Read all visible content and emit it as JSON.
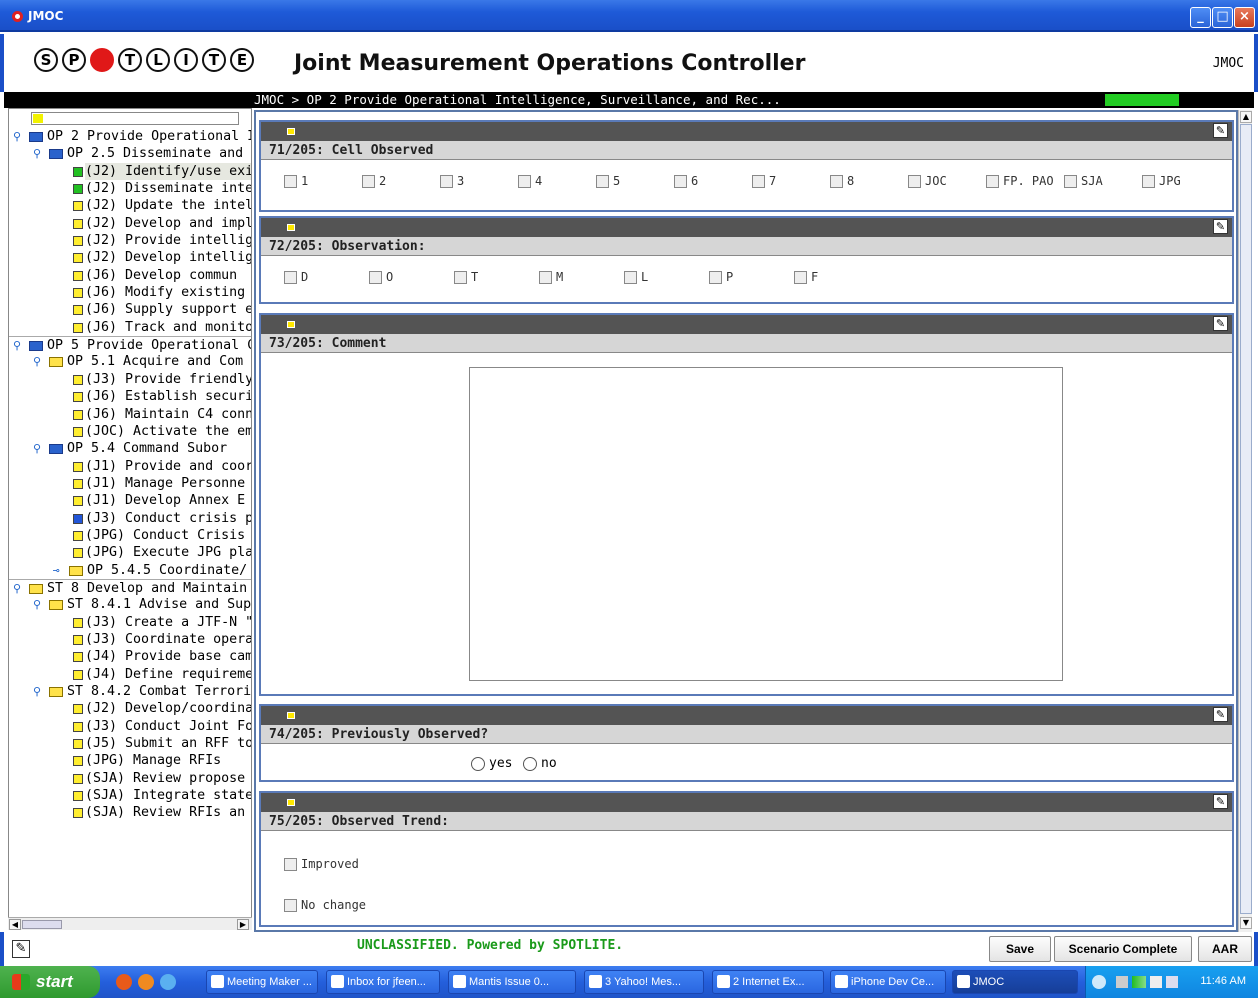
{
  "window": {
    "title": "JMOC",
    "controls": [
      "minimize",
      "maximize",
      "close"
    ]
  },
  "header": {
    "logo_letters": [
      "S",
      "P",
      "",
      "T",
      "L",
      "I",
      "T",
      "E"
    ],
    "title": "Joint Measurement Operations Controller",
    "tag": "JMOC"
  },
  "breadcrumb": {
    "text": "JMOC > OP 2 Provide Operational Intelligence, Surveillance, and Rec...",
    "status_color": "#22cc22"
  },
  "tree": {
    "rows": [
      {
        "label": "OP 2 Provide Operational I",
        "indent": 0,
        "kind": "folder-blue",
        "expand": "open",
        "sep": false
      },
      {
        "label": "OP 2.5 Disseminate and",
        "indent": 1,
        "kind": "folder-blue",
        "expand": "open",
        "sep": false
      },
      {
        "label": "(J2) Identify/use exis",
        "indent": 2,
        "kind": "green",
        "expand": "",
        "sep": false,
        "selected": true
      },
      {
        "label": "(J2) Disseminate intell",
        "indent": 2,
        "kind": "green",
        "expand": "",
        "sep": false
      },
      {
        "label": "(J2) Update the intelli",
        "indent": 2,
        "kind": "yellow",
        "expand": "",
        "sep": false
      },
      {
        "label": "(J2) Develop and impl",
        "indent": 2,
        "kind": "yellow",
        "expand": "",
        "sep": false
      },
      {
        "label": "(J2) Provide intelligen",
        "indent": 2,
        "kind": "yellow",
        "expand": "",
        "sep": false
      },
      {
        "label": "(J2) Develop intelliger",
        "indent": 2,
        "kind": "yellow",
        "expand": "",
        "sep": false
      },
      {
        "label": "(J6) Develop commun",
        "indent": 2,
        "kind": "yellow",
        "expand": "",
        "sep": false
      },
      {
        "label": "(J6) Modify existing cc",
        "indent": 2,
        "kind": "yellow",
        "expand": "",
        "sep": false
      },
      {
        "label": "(J6) Supply support e",
        "indent": 2,
        "kind": "yellow",
        "expand": "",
        "sep": false
      },
      {
        "label": "(J6) Track and monito",
        "indent": 2,
        "kind": "yellow",
        "expand": "",
        "sep": false
      },
      {
        "label": "OP 5 Provide Operational C",
        "indent": 0,
        "kind": "folder-blue",
        "expand": "open",
        "sep": true
      },
      {
        "label": "OP 5.1 Acquire and Com",
        "indent": 1,
        "kind": "folder-yellow",
        "expand": "open",
        "sep": false
      },
      {
        "label": "(J3) Provide friendly f",
        "indent": 2,
        "kind": "yellow",
        "expand": "",
        "sep": false
      },
      {
        "label": "(J6) Establish security",
        "indent": 2,
        "kind": "yellow",
        "expand": "",
        "sep": false
      },
      {
        "label": "(J6) Maintain C4 conn",
        "indent": 2,
        "kind": "yellow",
        "expand": "",
        "sep": false
      },
      {
        "label": "(JOC) Activate the em",
        "indent": 2,
        "kind": "yellow",
        "expand": "",
        "sep": false
      },
      {
        "label": "OP 5.4 Command Subor",
        "indent": 1,
        "kind": "folder-blue",
        "expand": "open",
        "sep": false
      },
      {
        "label": "(J1) Provide and coor",
        "indent": 2,
        "kind": "yellow",
        "expand": "",
        "sep": false
      },
      {
        "label": "(J1) Manage Personne",
        "indent": 2,
        "kind": "yellow",
        "expand": "",
        "sep": false
      },
      {
        "label": "(J1) Develop Annex E",
        "indent": 2,
        "kind": "yellow",
        "expand": "",
        "sep": false
      },
      {
        "label": "(J3) Conduct crisis pla",
        "indent": 2,
        "kind": "blue",
        "expand": "",
        "sep": false
      },
      {
        "label": "(JPG) Conduct Crisis A",
        "indent": 2,
        "kind": "yellow",
        "expand": "",
        "sep": false
      },
      {
        "label": "(JPG) Execute JPG pla",
        "indent": 2,
        "kind": "yellow",
        "expand": "",
        "sep": false
      },
      {
        "label": "OP 5.4.5 Coordinate/",
        "indent": 2,
        "kind": "folder-yellow",
        "expand": "closed",
        "sep": false
      },
      {
        "label": "ST 8 Develop and Maintain",
        "indent": 0,
        "kind": "folder-yellow",
        "expand": "open",
        "sep": true
      },
      {
        "label": "ST 8.4.1 Advise and Sup",
        "indent": 1,
        "kind": "folder-yellow",
        "expand": "open",
        "sep": false
      },
      {
        "label": "(J3) Create a JTF-N \"f",
        "indent": 2,
        "kind": "yellow",
        "expand": "",
        "sep": false
      },
      {
        "label": "(J3) Coordinate opera",
        "indent": 2,
        "kind": "yellow",
        "expand": "",
        "sep": false
      },
      {
        "label": "(J4) Provide base cam",
        "indent": 2,
        "kind": "yellow",
        "expand": "",
        "sep": false
      },
      {
        "label": "(J4) Define requireme",
        "indent": 2,
        "kind": "yellow",
        "expand": "",
        "sep": false
      },
      {
        "label": "ST 8.4.2 Combat Terrori",
        "indent": 1,
        "kind": "folder-yellow",
        "expand": "open",
        "sep": false
      },
      {
        "label": "(J2) Develop/coordina",
        "indent": 2,
        "kind": "yellow",
        "expand": "",
        "sep": false
      },
      {
        "label": "(J3) Conduct Joint Fo",
        "indent": 2,
        "kind": "yellow",
        "expand": "",
        "sep": false
      },
      {
        "label": "(J5) Submit an RFF to",
        "indent": 2,
        "kind": "yellow",
        "expand": "",
        "sep": false
      },
      {
        "label": "(JPG) Manage RFIs",
        "indent": 2,
        "kind": "yellow",
        "expand": "",
        "sep": false
      },
      {
        "label": "(SJA) Review propose",
        "indent": 2,
        "kind": "yellow",
        "expand": "",
        "sep": false
      },
      {
        "label": "(SJA) Integrate state",
        "indent": 2,
        "kind": "yellow",
        "expand": "",
        "sep": false
      },
      {
        "label": "(SJA) Review RFIs an",
        "indent": 2,
        "kind": "yellow",
        "expand": "",
        "sep": false
      }
    ]
  },
  "questions": {
    "q71": {
      "title": "71/205: Cell Observed",
      "options": [
        "1",
        "2",
        "3",
        "4",
        "5",
        "6",
        "7",
        "8",
        "JOC",
        "FP. PAO",
        "SJA",
        "JPG"
      ]
    },
    "q72": {
      "title": "72/205: Observation:",
      "options": [
        "D",
        "O",
        "T",
        "M",
        "L",
        "P",
        "F"
      ]
    },
    "q73": {
      "title": "73/205: Comment",
      "value": ""
    },
    "q74": {
      "title": "74/205: Previously Observed?",
      "yes": "yes",
      "no": "no"
    },
    "q75": {
      "title": "75/205: Observed Trend:",
      "options": [
        "Improved",
        "No change"
      ]
    }
  },
  "footer": {
    "classification": "UNCLASSIFIED. Powered by SPOTLITE.",
    "save": "Save",
    "scenario_complete": "Scenario Complete",
    "aar": "AAR"
  },
  "taskbar": {
    "start": "start",
    "tasks": [
      {
        "label": "Meeting Maker ...",
        "icon": "calendar-icon"
      },
      {
        "label": "Inbox for jfeen...",
        "icon": "mail-icon"
      },
      {
        "label": "Mantis Issue 0...",
        "icon": "browser-icon"
      },
      {
        "label": "3 Yahoo! Mes...",
        "icon": "yahoo-icon"
      },
      {
        "label": "2 Internet Ex...",
        "icon": "ie-icon"
      },
      {
        "label": "iPhone Dev Ce...",
        "icon": "firefox-icon"
      },
      {
        "label": "JMOC",
        "icon": "jmoc-icon"
      }
    ],
    "clock": "11:46 AM"
  }
}
